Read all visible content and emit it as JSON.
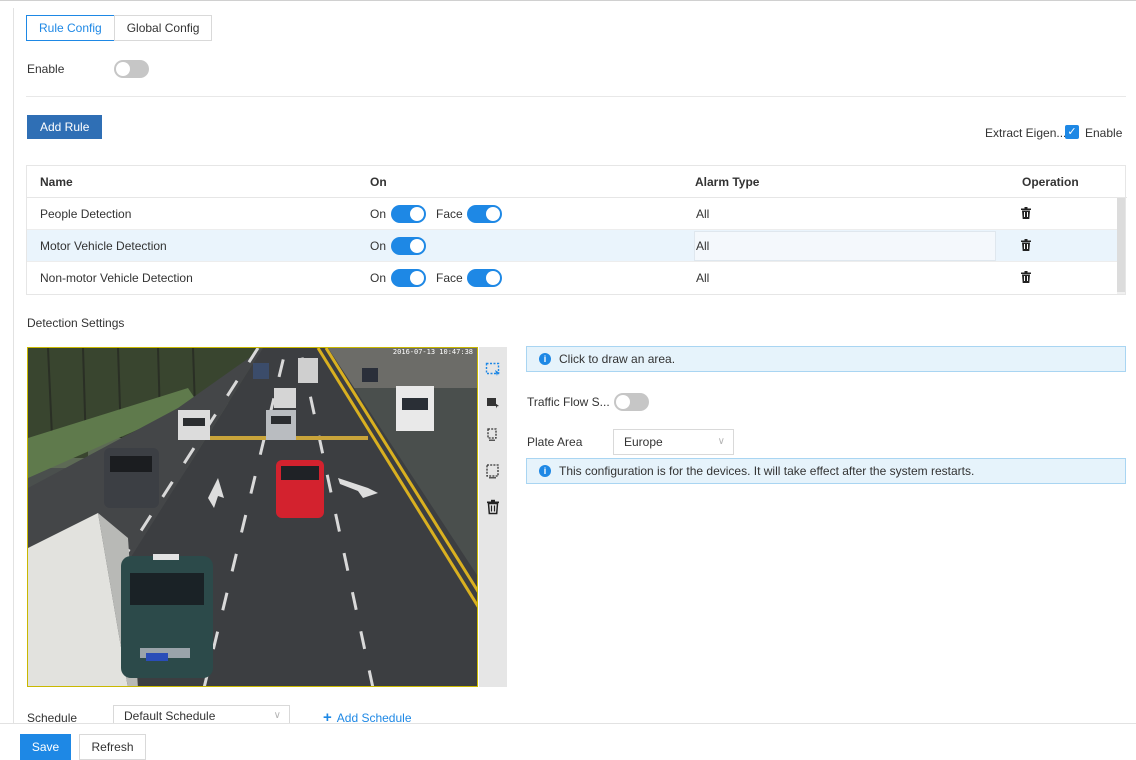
{
  "tabs": [
    {
      "label": "Rule Config",
      "active": true
    },
    {
      "label": "Global Config",
      "active": false
    }
  ],
  "enable": {
    "label": "Enable",
    "on": false
  },
  "add_rule_label": "Add Rule",
  "extract_eigen": {
    "label": "Extract Eigen...",
    "checkbox_label": "Enable",
    "checked": true
  },
  "table": {
    "headers": {
      "name": "Name",
      "on": "On",
      "alarm_type": "Alarm Type",
      "operation": "Operation"
    },
    "rows": [
      {
        "name": "People Detection",
        "on_label": "On",
        "on": true,
        "face_label": "Face",
        "face": true,
        "alarm_type": "All",
        "selected": false
      },
      {
        "name": "Motor Vehicle Detection",
        "on_label": "On",
        "on": true,
        "face_label": "",
        "face": null,
        "alarm_type": "All",
        "selected": true
      },
      {
        "name": "Non-motor Vehicle Detection",
        "on_label": "On",
        "on": true,
        "face_label": "Face",
        "face": true,
        "alarm_type": "All",
        "selected": false
      }
    ]
  },
  "detection_settings_label": "Detection Settings",
  "video": {
    "timestamp": "2016-07-13 10:47:38",
    "plates": [
      "C569",
      "A07C3",
      "A21SX"
    ]
  },
  "tools": [
    "draw-area-icon",
    "draw-exclude-area-icon",
    "draw-min-size-icon",
    "draw-max-size-icon",
    "delete-icon"
  ],
  "info_draw": "Click to draw an area.",
  "traffic_flow": {
    "label": "Traffic Flow S...",
    "on": false
  },
  "plate_area": {
    "label": "Plate Area",
    "value": "Europe"
  },
  "info_restart": "This configuration is for the devices. It will take effect after the system restarts.",
  "schedule": {
    "label": "Schedule",
    "value": "Default Schedule",
    "add_label": "Add Schedule"
  },
  "footer": {
    "save_label": "Save",
    "refresh_label": "Refresh"
  },
  "colors": {
    "accent": "#1e88e5",
    "add_rule_bg": "#2f6fb5",
    "info_bg": "#e6f3fb",
    "selected_row": "#eaf4fc"
  }
}
